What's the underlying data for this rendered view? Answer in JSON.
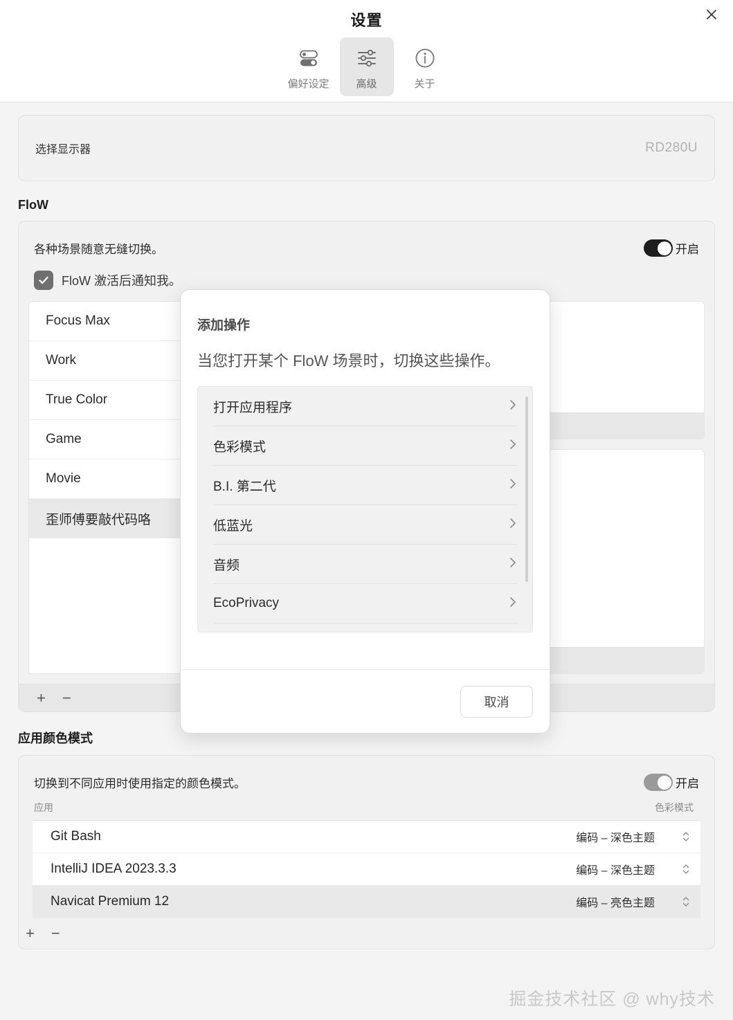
{
  "window": {
    "title": "设置",
    "close_icon": "close-icon"
  },
  "tabs": [
    {
      "id": "preferences",
      "label": "偏好设定",
      "icon": "toggles-icon",
      "active": false
    },
    {
      "id": "advanced",
      "label": "高级",
      "icon": "sliders-icon",
      "active": true
    },
    {
      "id": "about",
      "label": "关于",
      "icon": "info-icon",
      "active": false
    }
  ],
  "monitor": {
    "label": "选择显示器",
    "value": "RD280U"
  },
  "flow": {
    "section_title": "FloW",
    "description": "各种场景随意无缝切换。",
    "toggle_label": "开启",
    "toggle_on": true,
    "checkbox_label": "FloW 激活后通知我。",
    "checkbox_checked": true,
    "scenes": [
      {
        "name": "Focus Max",
        "selected": false
      },
      {
        "name": "Work",
        "selected": false
      },
      {
        "name": "True Color",
        "selected": false
      },
      {
        "name": "Game",
        "selected": false
      },
      {
        "name": "Movie",
        "selected": false
      },
      {
        "name": "歪师傅要敲代码咯",
        "selected": true
      }
    ],
    "add_label": "+",
    "remove_label": "−"
  },
  "app_color_mode": {
    "section_title": "应用颜色模式",
    "description": "切换到不同应用时使用指定的颜色模式。",
    "toggle_label": "开启",
    "toggle_on": true,
    "columns": {
      "app": "应用",
      "mode": "色彩模式"
    },
    "rows": [
      {
        "app": "Git Bash",
        "mode": "编码 – 深色主题",
        "selected": false
      },
      {
        "app": "IntelliJ IDEA 2023.3.3",
        "mode": "编码 – 深色主题",
        "selected": false
      },
      {
        "app": "Navicat Premium 12",
        "mode": "编码 – 亮色主题",
        "selected": true
      }
    ],
    "add_label": "+",
    "remove_label": "−"
  },
  "modal": {
    "title": "添加操作",
    "subtitle": "当您打开某个 FloW 场景时，切换这些操作。",
    "items": [
      {
        "label": "打开应用程序"
      },
      {
        "label": "色彩模式"
      },
      {
        "label": "B.I. 第二代"
      },
      {
        "label": "低蓝光"
      },
      {
        "label": "音频"
      },
      {
        "label": "EcoPrivacy"
      }
    ],
    "chevron": "›",
    "cancel_label": "取消"
  },
  "watermark": "掘金技术社区 @ why技术",
  "colors": {
    "page_bg": "#f4f4f4",
    "card_bg": "#f1f1f1",
    "toggle_on": "#1d1d1d",
    "toggle_muted": "#9a9a9a",
    "selected_row": "#e9e9e9",
    "muted_text": "#b2b2b2"
  }
}
